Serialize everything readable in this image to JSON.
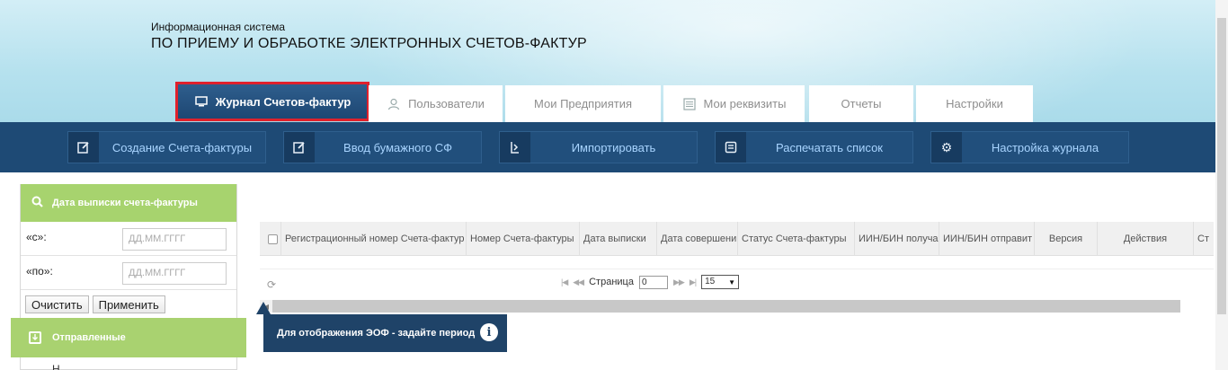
{
  "header": {
    "subtitle": "Информационная система",
    "title": "ПО ПРИЕМУ И ОБРАБОТКЕ ЭЛЕКТРОННЫХ СЧЕТОВ-ФАКТУР"
  },
  "tabs": [
    {
      "label": "Журнал Счетов-фактур",
      "icon": "monitor-icon",
      "active": true
    },
    {
      "label": "Пользователи",
      "icon": "user-icon"
    },
    {
      "label": "Мои Предприятия",
      "icon": ""
    },
    {
      "label": "Мои реквизиты",
      "icon": "list-icon"
    },
    {
      "label": "Отчеты",
      "icon": ""
    },
    {
      "label": "Настройки",
      "icon": ""
    }
  ],
  "toolbar": [
    {
      "label": "Создание Счета-фактуры",
      "icon": "edit-icon"
    },
    {
      "label": "Ввод бумажного СФ",
      "icon": "edit-icon"
    },
    {
      "label": "Импортировать",
      "icon": "import-icon"
    },
    {
      "label": "Распечатать список",
      "icon": "print-icon"
    },
    {
      "label": "Настройка журнала",
      "icon": "gear-icon"
    }
  ],
  "filter": {
    "title": "Дата выписки счета-фактуры",
    "from_label": "«с»:",
    "from_placeholder": "ДД.ММ.ГГГГ",
    "to_label": "«по»:",
    "to_placeholder": "ДД.ММ.ГГГГ",
    "clear_label": "Очистить",
    "apply_label": "Применить"
  },
  "sent": {
    "title": "Отправленные",
    "next_item": "Н"
  },
  "grid": {
    "columns": [
      "Регистрационный номер Счета-фактур",
      "Номер Счета-фактуры",
      "Дата выписки",
      "Дата совершени",
      "Статус Счета-фактуры",
      "ИИН/БИН получа",
      "ИИН/БИН отправит",
      "Версия",
      "Действия",
      "Ст"
    ]
  },
  "pager": {
    "page_label": "Страница",
    "page_value": "0",
    "page_size": "15"
  },
  "tooltip": {
    "text": "Для отображения ЭОФ - задайте период"
  },
  "colors": {
    "header_bg": "#b5e1ee",
    "toolbar_bg": "#1e4a75",
    "active_tab": "#1d4672",
    "highlight": "#e0212c",
    "filter_green": "#a7d36e",
    "tooltip_bg": "#1f4368",
    "toolbar_text": "#a8d4ff"
  }
}
